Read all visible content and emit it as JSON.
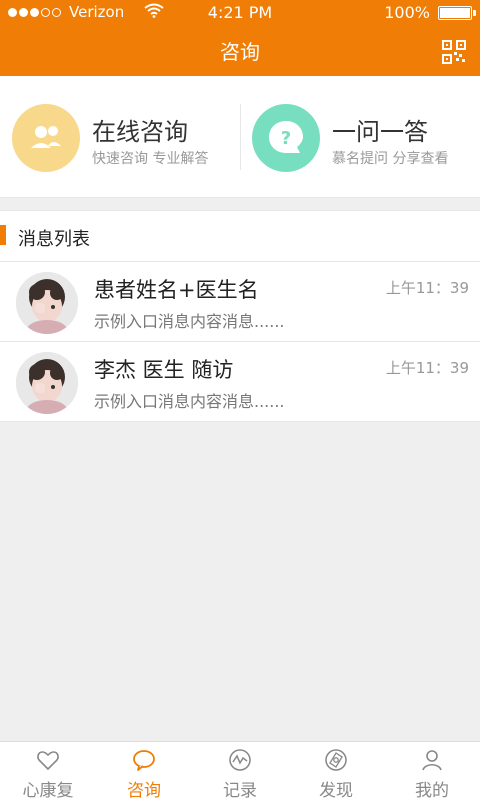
{
  "status_bar": {
    "carrier": "Verizon",
    "time": "4:21 PM",
    "battery": "100%"
  },
  "header": {
    "title": "咨询",
    "qr_icon": "qr-code-icon"
  },
  "entries": [
    {
      "title": "在线咨询",
      "subtitle": "快速咨询 专业解答",
      "icon": "group-user-icon",
      "color": "#f8d88b"
    },
    {
      "title": "一问一答",
      "subtitle": "慕名提问  分享查看",
      "icon": "question-bubble-icon",
      "color": "#77dfc0"
    }
  ],
  "messages_section": {
    "title": "消息列表",
    "accent": "#f07d05"
  },
  "messages": [
    {
      "name": "患者姓名+医生名",
      "time": "上午11：39",
      "preview": "示例入口消息内容消息......"
    },
    {
      "name": "李杰 医生 随访",
      "time": "上午11：39",
      "preview": "示例入口消息内容消息......"
    }
  ],
  "tabs": [
    {
      "label": "心康复",
      "icon": "heart-icon",
      "active": false
    },
    {
      "label": "咨询",
      "icon": "chat-bubble-icon",
      "active": true
    },
    {
      "label": "记录",
      "icon": "pulse-icon",
      "active": false
    },
    {
      "label": "发现",
      "icon": "compass-icon",
      "active": false
    },
    {
      "label": "我的",
      "icon": "person-icon",
      "active": false
    }
  ]
}
